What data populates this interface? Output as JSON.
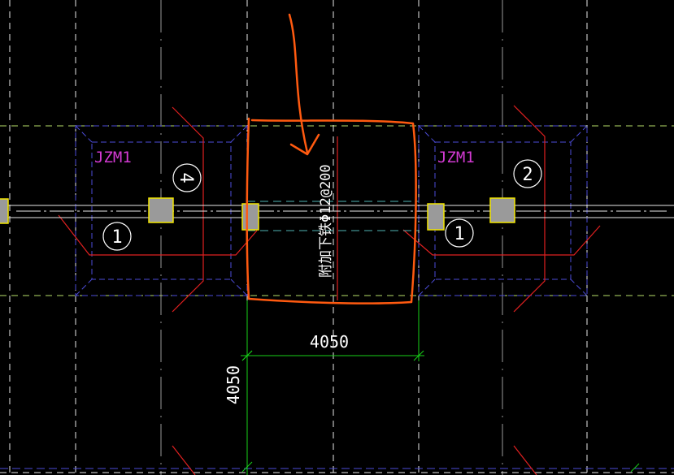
{
  "labels": {
    "pile_cap_left": "JZM1",
    "pile_cap_right": "JZM1",
    "dimension_horizontal": "4050",
    "dimension_vertical": "4050",
    "rebar_note": "附加下铁Φ12@200"
  },
  "markers": [
    "1",
    "4",
    "1",
    "2"
  ],
  "colors": {
    "background": "#000000",
    "grid_dashed": "#e8e8e8",
    "grid_secondary": "#b9e06a",
    "axis_dashed": "#4fb3b3",
    "cap_outline": "#4c4cd8",
    "rebar_red": "#e02020",
    "dimension_green": "#18d018",
    "annotation_orange": "#ff5a10",
    "label_magenta": "#d33ad3",
    "column_fill": "#9a9a9a",
    "end_fill": "#f2e600"
  }
}
